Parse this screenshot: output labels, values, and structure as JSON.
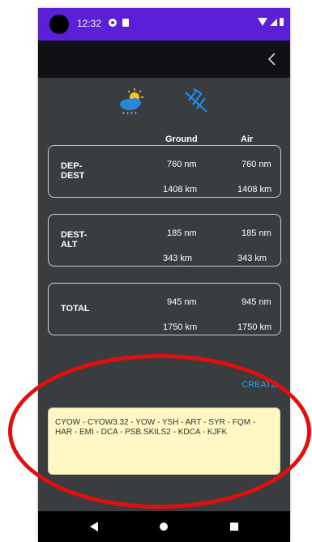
{
  "status_bar": {
    "time": "12:32"
  },
  "columns": {
    "ground": "Ground",
    "air": "Air"
  },
  "rows": [
    {
      "label": "DEP-\nDEST",
      "ground_nm": "760 nm",
      "air_nm": "760 nm",
      "ground_km": "1408 km",
      "air_km": "1408 km"
    },
    {
      "label": "DEST-\nALT",
      "ground_nm": "185 nm",
      "air_nm": "185 nm",
      "ground_km": "343 km",
      "air_km": "343 km"
    },
    {
      "label": "TOTAL",
      "ground_nm": "945 nm",
      "air_nm": "945 nm",
      "ground_km": "1750 km",
      "air_km": "1750 km"
    }
  ],
  "create_label": "CREATE",
  "route_text": "CYOW - CYOW3.32 - YOW - YSH - ART - SYR - FQM - HAR - EMI - DCA - PSB.SKILS2 - KDCA - KJFK",
  "colors": {
    "status_bar": "#5a1fd6",
    "background": "#3a3d40",
    "accent": "#2ea2e0",
    "highlight": "#e30f0f",
    "route_box": "#fff8c4"
  },
  "icons": {
    "back": "chevron-left-icon",
    "weather": "weather-icon",
    "wind": "wind-icon"
  }
}
